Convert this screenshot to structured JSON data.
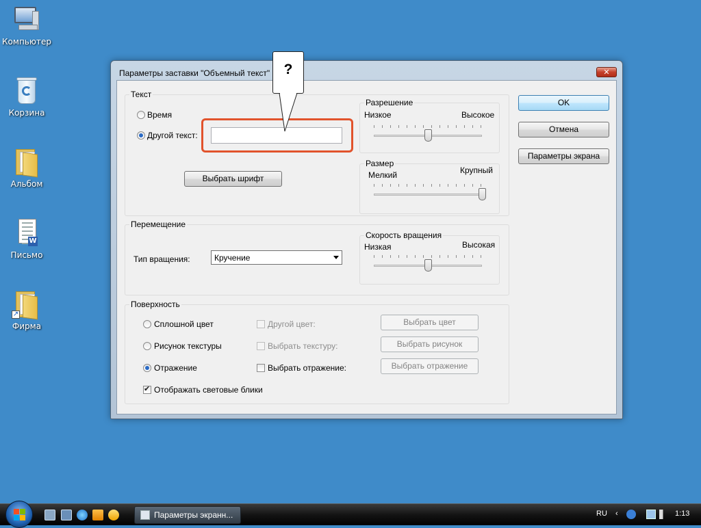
{
  "desktop": {
    "icons": [
      {
        "label": "Компьютер"
      },
      {
        "label": "Корзина"
      },
      {
        "label": "Альбом"
      },
      {
        "label": "Письмо"
      },
      {
        "label": "Фирма"
      }
    ]
  },
  "dialog": {
    "title": "Параметры заставки \"Объемный текст\"",
    "close_label": "✕",
    "callout": "?",
    "text_group": {
      "legend": "Текст",
      "radio_time": "Время",
      "radio_other_text": "Другой текст:",
      "other_text_value": "",
      "selected": "Другой текст:",
      "font_button": "Выбрать шрифт"
    },
    "resolution": {
      "legend": "Разрешение",
      "low": "Низкое",
      "high": "Высокое",
      "level": 0.5
    },
    "size": {
      "legend": "Размер",
      "small": "Мелкий",
      "large": "Крупный",
      "level": 1.0
    },
    "motion_group": {
      "legend": "Перемещение",
      "rotation_type_label": "Тип вращения:",
      "rotation_type_value": "Кручение"
    },
    "rotation_speed": {
      "legend": "Скорость вращения",
      "low": "Низкая",
      "high": "Высокая",
      "level": 0.5
    },
    "surface_group": {
      "legend": "Поверхность",
      "radio_solid": "Сплошной цвет",
      "radio_texture": "Рисунок текстуры",
      "radio_reflection": "Отражение",
      "selected": "Отражение",
      "check_other_color": "Другой цвет:",
      "check_texture": "Выбрать текстуру:",
      "check_reflection": "Выбрать отражение:",
      "btn_color": "Выбрать цвет",
      "btn_picture": "Выбрать рисунок",
      "btn_reflection": "Выбрать отражение",
      "highlights": "Отображать световые блики",
      "highlights_checked": true
    },
    "buttons": {
      "ok": "OK",
      "cancel": "Отмена",
      "screen_settings": "Параметры экрана"
    }
  },
  "taskbar": {
    "task_label": "Параметры экранн...",
    "language": "RU",
    "time": "1:13"
  },
  "colors": {
    "desktop": "#3f8bc9",
    "highlight": "#e1532c"
  }
}
